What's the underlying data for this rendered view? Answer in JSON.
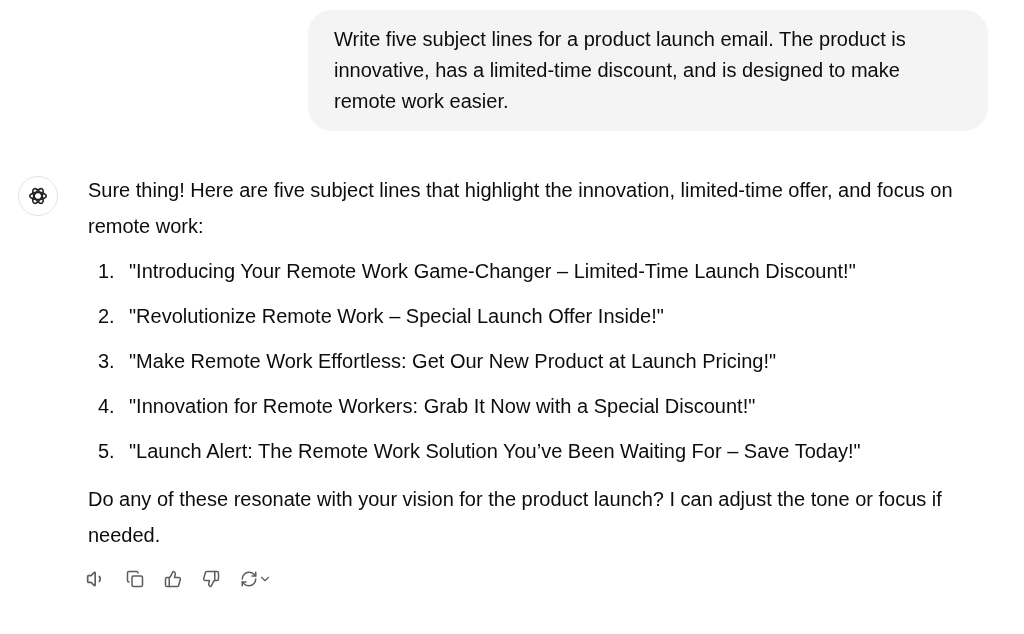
{
  "user_message": "Write five subject lines for a product launch email. The product is innovative, has a limited-time discount, and is designed to make remote work easier.",
  "assistant": {
    "intro": "Sure thing! Here are five subject lines that highlight the innovation, limited-time offer, and focus on remote work:",
    "items": [
      {
        "number": "1.",
        "text": "\"Introducing Your Remote Work Game-Changer – Limited-Time Launch Discount!\""
      },
      {
        "number": "2.",
        "text": "\"Revolutionize Remote Work – Special Launch Offer Inside!\""
      },
      {
        "number": "3.",
        "text": "\"Make Remote Work Effortless: Get Our New Product at Launch Pricing!\""
      },
      {
        "number": "4.",
        "text": "\"Innovation for Remote Workers: Grab It Now with a Special Discount!\""
      },
      {
        "number": "5.",
        "text": "\"Launch Alert: The Remote Work Solution You’ve Been Waiting For – Save Today!\""
      }
    ],
    "outro": "Do any of these resonate with your vision for the product launch? I can adjust the tone or focus if needed."
  }
}
